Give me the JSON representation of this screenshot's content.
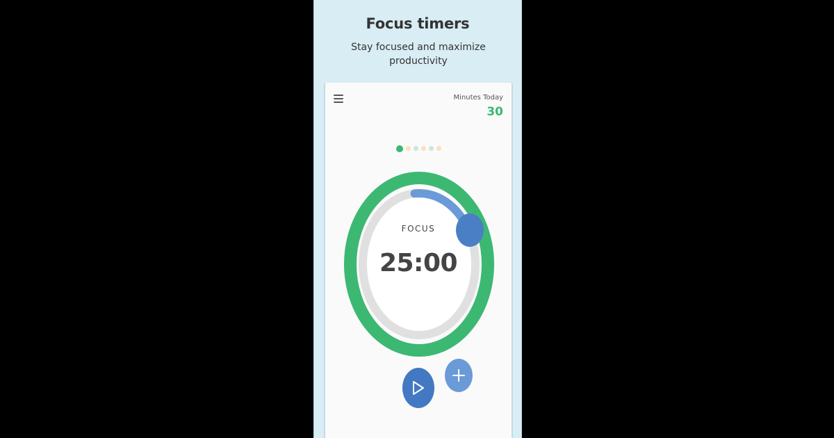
{
  "header": {
    "title": "Focus timers",
    "subtitle": "Stay focused and maximize productivity"
  },
  "app": {
    "menu_icon": "hamburger-menu-icon",
    "stats": {
      "label": "Minutes Today",
      "value": "30"
    },
    "pager": {
      "count": 6,
      "active_index": 0,
      "colors": [
        "#3cb873",
        "#fde0bd",
        "#c8e8d8",
        "#fde0bd",
        "#c8e8d8",
        "#fde0bd"
      ]
    },
    "timer": {
      "mode": "FOCUS",
      "time": "25:00",
      "progress_fraction": 0.15
    },
    "controls": {
      "play_icon": "play-icon",
      "add_icon": "plus-icon"
    }
  },
  "colors": {
    "background": "#000000",
    "banner": "#d8edf4",
    "card": "#fafafa",
    "accent_green": "#3cb873",
    "track_gray": "#e0e0e0",
    "progress_blue": "#6a9bd8",
    "handle_blue": "#4a7fc6",
    "play_blue": "#4379c2",
    "text": "#444444"
  }
}
